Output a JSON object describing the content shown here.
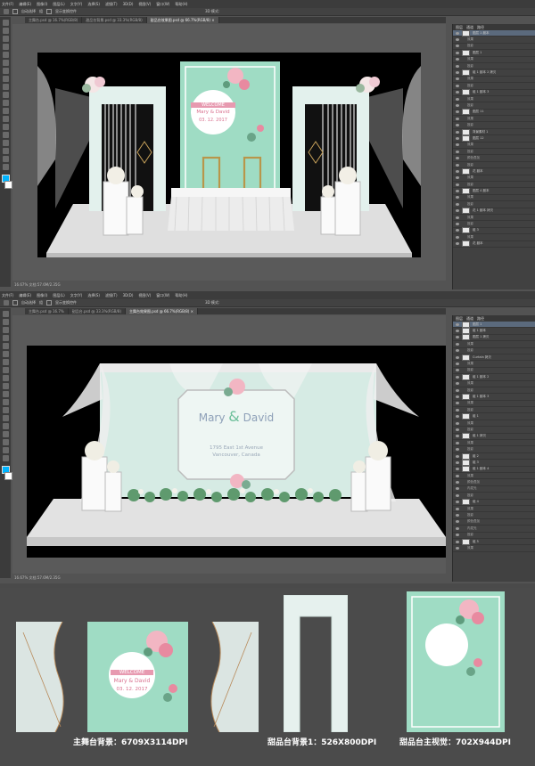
{
  "menu": [
    "文件(F)",
    "编辑(E)",
    "图像(I)",
    "图层(L)",
    "文字(Y)",
    "选择(S)",
    "滤镜(T)",
    "3D(D)",
    "视图(V)",
    "窗口(W)",
    "帮助(H)"
  ],
  "options": {
    "auto_select": "自动选择",
    "group": "组",
    "show_transform": "显示变换控件",
    "mode_3d": "3D 模式:"
  },
  "window1": {
    "tabs": [
      "主舞台.psd @ 16.7%(RGB/8)",
      "甜品台背景.psd @ 33.3%(RGB/8)",
      "甜品台效果图.psd @ 66.7%(RGB/8) ×"
    ],
    "status": "16.67%   文档:57.6M/2.35G"
  },
  "window2": {
    "tabs": [
      "主舞台.psd @ 16.7%",
      "甜品台.psd @ 33.3%(RGB/8)",
      "主舞台效果图.psd @ 66.7%(RGB/8) ×"
    ],
    "status": "16.67%   文档:57.6M/2.35G"
  },
  "layers_panel": {
    "tabs": [
      "图层",
      "通道",
      "路径"
    ],
    "rows1": [
      "图层 1 副本",
      "效果",
      "投影",
      "图层 1",
      "效果",
      "投影",
      "组 1 副本 2 拷贝",
      "效果",
      "投影",
      "组 1 副本 3",
      "效果",
      "投影",
      "图层 11",
      "效果",
      "投影",
      "背景素材 1",
      "图层 12",
      "效果",
      "投影",
      "颜色叠加",
      "投影",
      "花 副本",
      "效果",
      "投影",
      "图层 4 副本",
      "效果",
      "投影",
      "花 1 副本 拷贝",
      "效果",
      "投影",
      "组 3",
      "效果",
      "花 副本"
    ],
    "rows2": [
      "图层 1",
      "组 1 副本",
      "图层 1 拷贝",
      "效果",
      "投影",
      "Curtain 拷贝",
      "效果",
      "投影",
      "组 1 副本 2",
      "效果",
      "投影",
      "组 1 副本 3",
      "效果",
      "投影",
      "组 1",
      "效果",
      "投影",
      "组 1 拷贝",
      "效果",
      "投影",
      "组 2",
      "组 3",
      "组 1 副本 4",
      "效果",
      "颜色叠加",
      "内发光",
      "投影",
      "组 4",
      "效果",
      "投影",
      "颜色叠加",
      "内发光",
      "投影",
      "组 5",
      "效果"
    ]
  },
  "render1": {
    "welcome": "WELCOME",
    "names": "Mary & David",
    "date": "03. 12. 2017"
  },
  "render2": {
    "name_left": "Mary",
    "amp": "&",
    "name_right": "David",
    "address1": "1795 East 1st Avenue",
    "address2": "Vancouver, Canada"
  },
  "panel_main": {
    "welcome": "WELCOME",
    "names": "Mary & David",
    "date": "03. 12. 2017"
  },
  "captions": {
    "main": "主舞台背景：6709X3114DPI",
    "dessert_bg": "甜品台背景1：526X800DPI",
    "dessert_main": "甜品台主视觉：702X944DPI"
  },
  "colors": {
    "mint": "#9fdcc4",
    "pale_mint": "#d6ebe4",
    "pink": "#f2b6c3",
    "ui_dark": "#535353",
    "accent_blue": "#00b4ff"
  }
}
